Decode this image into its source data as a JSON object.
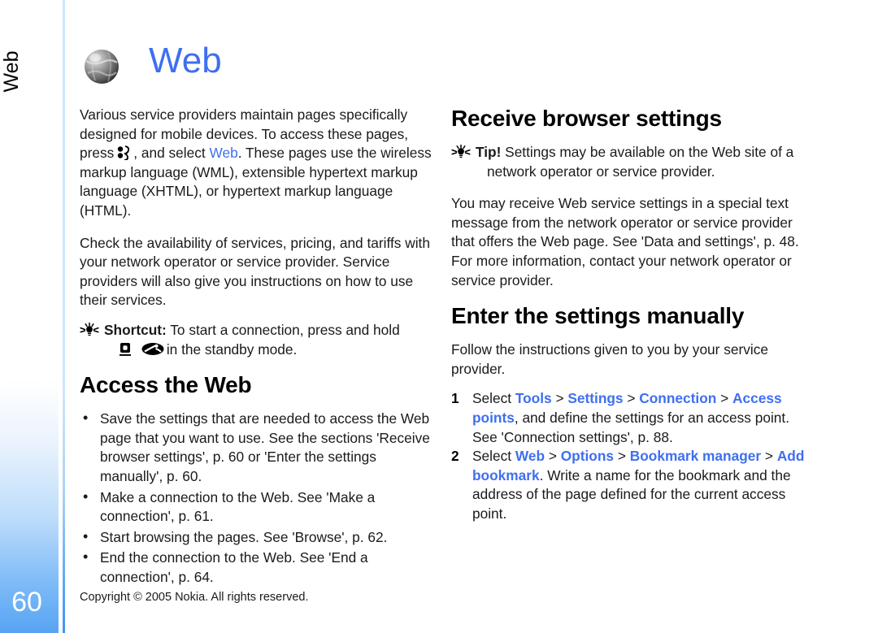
{
  "sidebar": {
    "tab_label": "Web",
    "page_number": "60"
  },
  "chapter": {
    "title": "Web",
    "icon": "globe-icon"
  },
  "left_column": {
    "intro_part1": "Various service providers maintain pages specifically designed for mobile devices. To access these pages, press",
    "intro_part2": ", and select",
    "intro_link": "Web",
    "intro_part3": ". These pages use the wireless markup language (WML), extensible hypertext markup language (XHTML), or hypertext markup language (HTML).",
    "availability": "Check the availability of services, pricing, and tariffs with your network operator or service provider. Service providers will also give you instructions on how to use their services.",
    "shortcut_label": "Shortcut:",
    "shortcut_text": "To start a connection, press and hold",
    "shortcut_tail": "in the standby mode.",
    "section_title": "Access the Web",
    "bullets": [
      "Save the settings that are needed to access the Web page that you want to use. See the sections 'Receive browser settings', p. 60 or 'Enter the settings manually', p. 60.",
      "Make a connection to the Web. See 'Make a connection', p. 61.",
      "Start browsing the pages. See 'Browse', p. 62.",
      "End the connection to the Web. See 'End a connection', p. 64."
    ]
  },
  "right_column": {
    "section1_title": "Receive browser settings",
    "tip_label": "Tip!",
    "tip_text": "Settings may be available on the Web site of a",
    "tip_text_line2": "network operator or service provider.",
    "paragraph": "You may receive Web service settings in a special text message from the network operator or service provider that offers the Web page. See 'Data and settings', p. 48. For more information, contact your network operator or service provider.",
    "section2_title": "Enter the settings manually",
    "intro": "Follow the instructions given to you by your service provider.",
    "steps": [
      {
        "num": "1",
        "pre": "Select",
        "links": [
          "Tools",
          "Settings",
          "Connection",
          "Access points"
        ],
        "post": ", and define the settings for an access point. See 'Connection settings', p. 88."
      },
      {
        "num": "2",
        "pre": "Select",
        "links": [
          "Web",
          "Options",
          "Bookmark manager",
          "Add bookmark"
        ],
        "post": ". Write a name for the bookmark and the address of the page defined for the current access point."
      }
    ],
    "separator": ">"
  },
  "footer": {
    "copyright": "Copyright © 2005 Nokia. All rights reserved."
  },
  "colors": {
    "link_blue": "#3f6ff0",
    "tab_blue": "#57a4f3",
    "rule_blue": "#cde6fb"
  }
}
